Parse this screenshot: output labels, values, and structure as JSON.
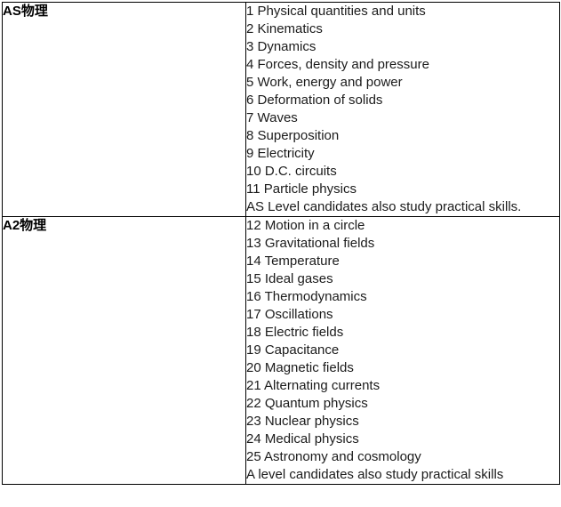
{
  "table": {
    "rows": [
      {
        "label": "AS物理",
        "topics": [
          "1 Physical quantities and units",
          "2 Kinematics",
          "3 Dynamics",
          "4 Forces, density and pressure",
          "5 Work, energy and power",
          "6 Deformation of solids",
          "7 Waves",
          "8 Superposition",
          "9 Electricity",
          "10 D.C. circuits",
          "11 Particle physics",
          "AS Level candidates also study practical skills."
        ]
      },
      {
        "label": "A2物理",
        "topics": [
          "12 Motion in a circle",
          "13 Gravitational fields",
          "14 Temperature",
          "15 Ideal gases",
          "16 Thermodynamics",
          "17 Oscillations",
          "18 Electric fields",
          "19 Capacitance",
          "20 Magnetic fields",
          "21 Alternating currents",
          "22 Quantum physics",
          "23 Nuclear physics",
          "24 Medical physics",
          "25 Astronomy and cosmology",
          "A level candidates also study practical skills"
        ]
      }
    ]
  },
  "colors": {
    "border": "#000000",
    "text": "#1b1b1b",
    "label_text": "#000000",
    "background": "#ffffff"
  }
}
